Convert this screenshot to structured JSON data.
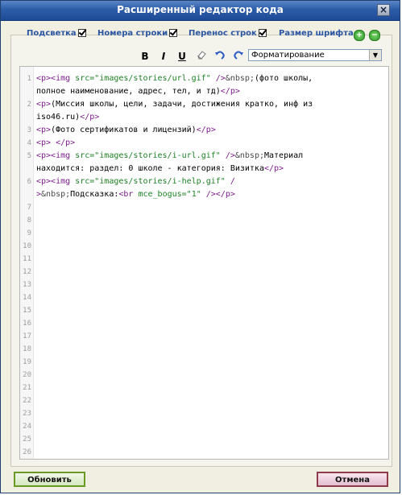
{
  "window": {
    "title": "Расширенный редактор кода"
  },
  "options": {
    "highlight": "Подсветка",
    "line_numbers": "Номера строки",
    "wrap": "Перенос строк",
    "font_size": "Размер шрифта"
  },
  "toolbar": {
    "bold": "B",
    "italic": "I",
    "underline": "U",
    "format_selected": "Форматирование"
  },
  "line_numbers": [
    "1",
    "2",
    "3",
    "4",
    "5",
    "6",
    "7",
    "8",
    "9",
    "10",
    "11",
    "12",
    "13",
    "14",
    "15",
    "16",
    "17",
    "18",
    "19",
    "20",
    "21",
    "22",
    "23",
    "24",
    "25",
    "26"
  ],
  "code_lines": [
    {
      "parts": [
        [
          "tag",
          "<p><img "
        ],
        [
          "str",
          "src=\"images/stories/url.gif\""
        ],
        [
          "tag",
          " />"
        ],
        [
          "ent",
          "&nbsp;"
        ],
        [
          "txt",
          "(фото школы,"
        ]
      ]
    },
    {
      "parts": [
        [
          "txt",
          "полное наименование, адрес, тел, и тд)"
        ],
        [
          "tag",
          "</p>"
        ]
      ]
    },
    {
      "parts": [
        [
          "tag",
          "<p>"
        ],
        [
          "txt",
          "(Миссия школы, цели, задачи, достижения кратко, инф из"
        ]
      ]
    },
    {
      "parts": [
        [
          "txt",
          "iso46.ru)"
        ],
        [
          "tag",
          "</p>"
        ]
      ]
    },
    {
      "parts": [
        [
          "tag",
          "<p>"
        ],
        [
          "txt",
          "(Фото сертификатов и лицензий)"
        ],
        [
          "tag",
          "</p>"
        ]
      ]
    },
    {
      "parts": [
        [
          "tag",
          "<p> </p>"
        ]
      ]
    },
    {
      "parts": [
        [
          "tag",
          "<p><img "
        ],
        [
          "str",
          "src=\"images/stories/i-url.gif\""
        ],
        [
          "tag",
          " />"
        ],
        [
          "ent",
          "&nbsp;"
        ],
        [
          "txt",
          "Материал"
        ]
      ]
    },
    {
      "parts": [
        [
          "txt",
          "находится: раздел: 0 школе - категория: Визитка"
        ],
        [
          "tag",
          "</p>"
        ]
      ]
    },
    {
      "parts": [
        [
          "tag",
          "<p><img "
        ],
        [
          "str",
          "src=\"images/stories/i-help.gif\""
        ],
        [
          "tag",
          " /"
        ]
      ]
    },
    {
      "parts": [
        [
          "tag",
          ">"
        ],
        [
          "ent",
          "&nbsp;"
        ],
        [
          "txt",
          "Подсказка:"
        ],
        [
          "tag",
          "<br "
        ],
        [
          "str",
          "mce_bogus=\"1\""
        ],
        [
          "tag",
          " /></p>"
        ]
      ]
    }
  ],
  "buttons": {
    "update": "Обновить",
    "cancel": "Отмена"
  }
}
